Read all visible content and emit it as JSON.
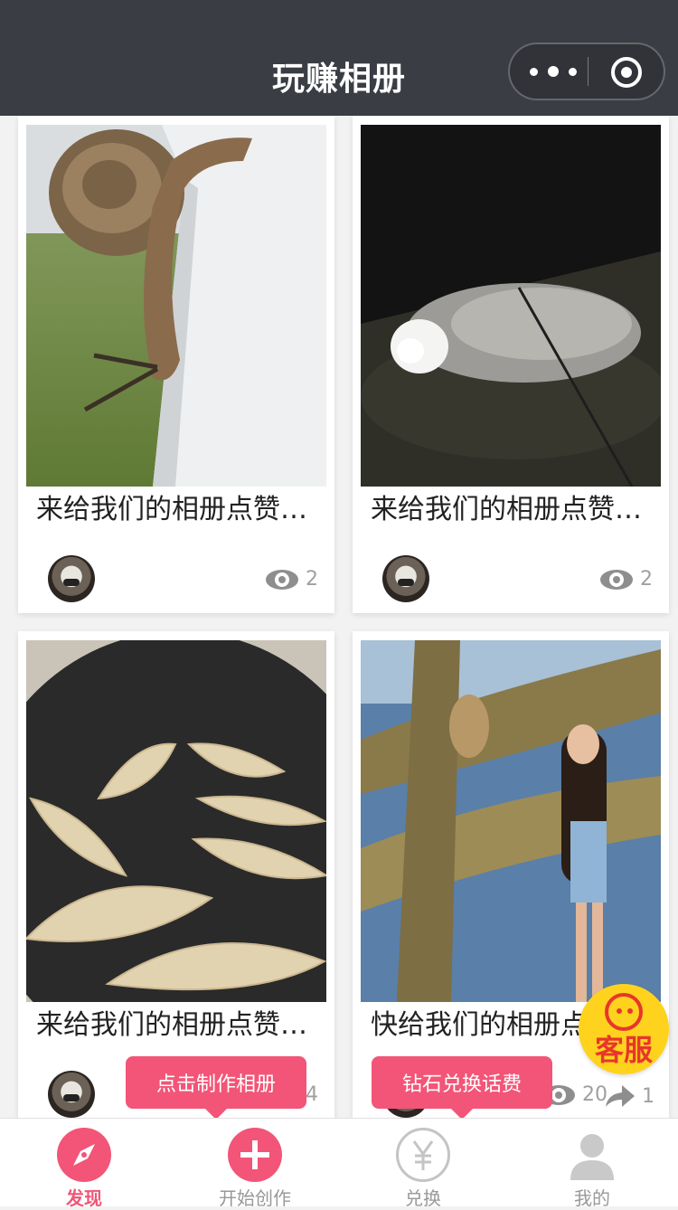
{
  "header": {
    "title": "玩赚相册"
  },
  "cards": [
    {
      "title": "来给我们的相册点赞…",
      "views": "2"
    },
    {
      "title": "来给我们的相册点赞…",
      "views": "2"
    },
    {
      "title": "来给我们的相册点赞…",
      "views": "4"
    },
    {
      "title": "快给我们的相册点",
      "views": "20",
      "shares": "1"
    }
  ],
  "tooltips": {
    "make_album": "点击制作相册",
    "diamond_exchange": "钻石兑换话费"
  },
  "customer_service": {
    "label": "客服"
  },
  "tabbar": {
    "items": [
      {
        "label": "发现",
        "icon": "compass-icon",
        "active": true
      },
      {
        "label": "开始创作",
        "icon": "plus-icon"
      },
      {
        "label": "兑换",
        "icon": "yuan-icon"
      },
      {
        "label": "我的",
        "icon": "user-icon"
      }
    ]
  },
  "colors": {
    "navbar": "#3a3d44",
    "accent": "#f25577",
    "kefu_bg": "#ffd21e",
    "kefu_red": "#e8362b"
  }
}
